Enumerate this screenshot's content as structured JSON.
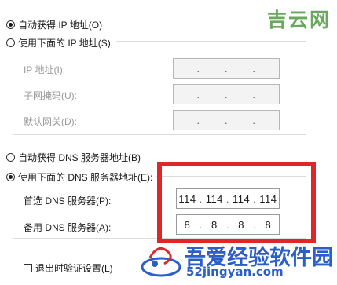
{
  "ip_section": {
    "auto_ip_label": "自动获得 IP 地址(O)",
    "manual_ip_label": "使用下面的 IP 地址(S):",
    "ip_address_label": "IP 地址(I):",
    "subnet_mask_label": "子网掩码(U):",
    "gateway_label": "默认网关(D):",
    "empty_octet": "",
    "dot": "."
  },
  "dns_section": {
    "auto_dns_label": "自动获得 DNS 服务器地址(B)",
    "manual_dns_label": "使用下面的 DNS 服务器地址(E):",
    "preferred_label": "首选 DNS 服务器(P):",
    "alternate_label": "备用 DNS 服务器(A):",
    "preferred_octets": [
      "114",
      "114",
      "114",
      "114"
    ],
    "alternate_octets": [
      "8",
      "8",
      "8",
      "8"
    ],
    "dot": "."
  },
  "validate_label": "退出时验证设置(L)",
  "watermarks": {
    "top": "吉云网",
    "bottom_text": "吾爱经验软件园",
    "bottom_url": "52jingyan.com"
  },
  "colors": {
    "highlight_frame": "#e02626",
    "watermark_green": "#4e9b43",
    "watermark_blue": "#2a5ec9"
  },
  "selection": {
    "ip_mode": "auto",
    "dns_mode": "manual",
    "validate_on_exit": false
  }
}
